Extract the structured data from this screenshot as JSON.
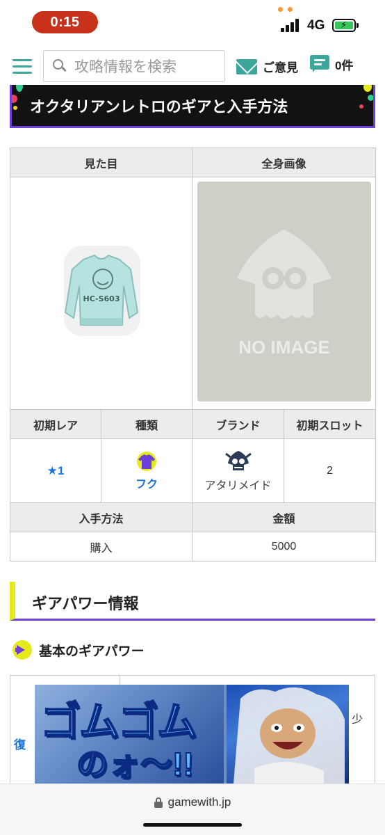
{
  "status_bar": {
    "time": "0:15",
    "network": "4G"
  },
  "header": {
    "search_placeholder": "攻略情報を検索",
    "feedback_label": "ご意見",
    "comments_label": "0件"
  },
  "section_title": "オクタリアンレトロのギアと入手方法",
  "gear_table": {
    "headers_top": [
      "見た目",
      "全身画像"
    ],
    "no_image_text": "NO IMAGE",
    "shirt_print": "HC-S603",
    "headers_mid": [
      "初期レア",
      "種類",
      "ブランド",
      "初期スロット"
    ],
    "rarity": "★1",
    "type": "フク",
    "brand": "アタリメイド",
    "initial_slots": "2",
    "headers_bottom": [
      "入手方法",
      "金額"
    ],
    "obtain_method": "購入",
    "price": "5000"
  },
  "gear_power": {
    "heading": "ギアパワー情報",
    "basic_label": "基本のギアパワー",
    "cell_left_partial": "復",
    "cell_right_partial": "少"
  },
  "ad": {
    "line1": "ゴムゴム",
    "line2": "のォ〜!!"
  },
  "url_bar": {
    "domain": "gamewith.jp"
  },
  "colors": {
    "accent_teal": "#3aa79a",
    "accent_purple": "#6d3fd6",
    "accent_yellow": "#e6ea1a",
    "link_blue": "#1b74d9",
    "time_pill": "#c8321a"
  }
}
